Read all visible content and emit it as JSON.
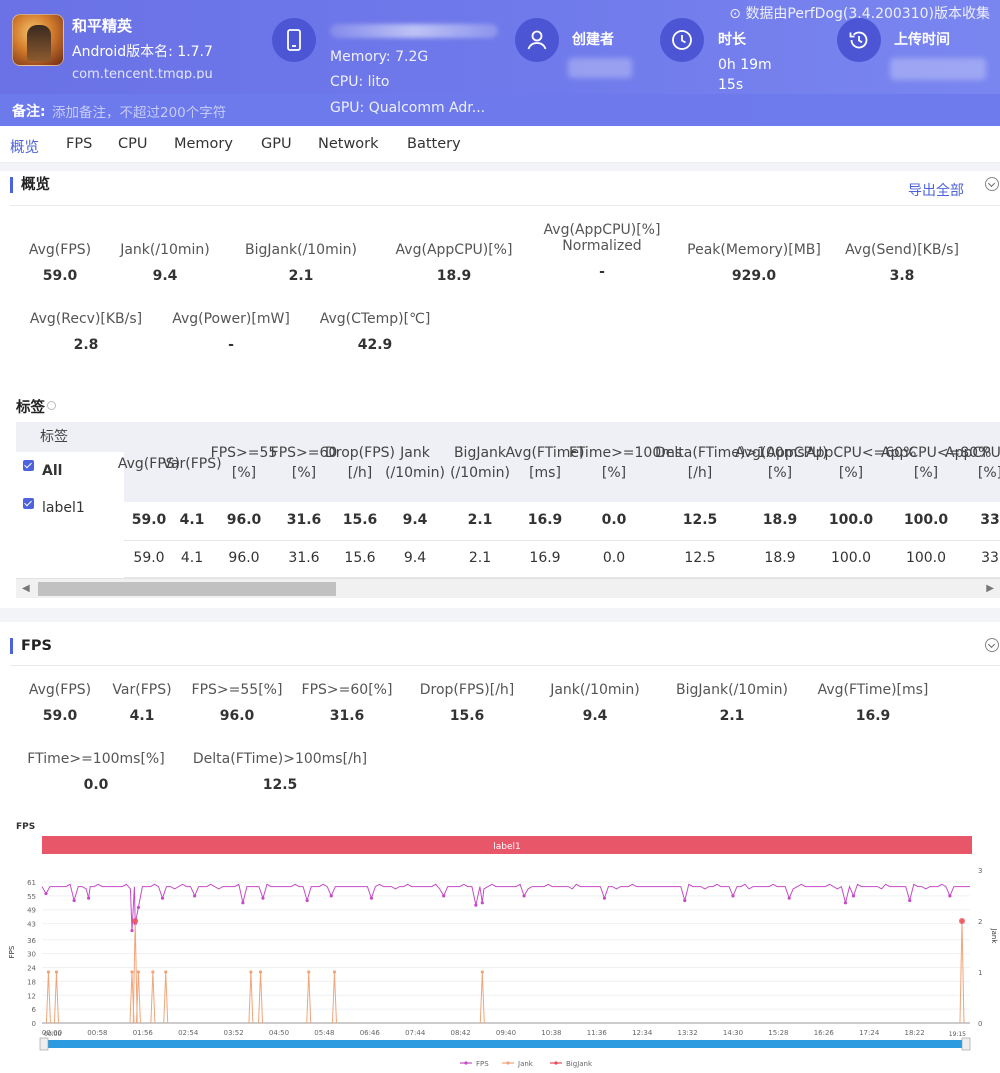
{
  "header": {
    "app_name": "和平精英",
    "app_version": "Android版本名: 1.7.7",
    "app_package": "com.tencent.tmgp.pu",
    "device_memory": "Memory: 7.2G",
    "device_cpu": "CPU: lito",
    "device_gpu": "GPU: Qualcomm Adr...",
    "creator_label": "创建者",
    "duration_label": "时长",
    "duration_value_1": "0h 19m",
    "duration_value_2": "15s",
    "upload_label": "上传时间",
    "collect_note": "数据由PerfDog(3.4.200310)版本收集",
    "note_label": "备注:",
    "note_placeholder": "添加备注，不超过200个字符"
  },
  "tabs": [
    "概览",
    "FPS",
    "CPU",
    "Memory",
    "GPU",
    "Network",
    "Battery"
  ],
  "overview": {
    "title": "概览",
    "export_label": "导出全部",
    "metrics_row1": [
      {
        "label": "Avg(FPS)",
        "value": "59.0"
      },
      {
        "label": "Jank(/10min)",
        "value": "9.4"
      },
      {
        "label": "BigJank(/10min)",
        "value": "2.1"
      },
      {
        "label": "Avg(AppCPU)[%]",
        "value": "18.9"
      },
      {
        "label": "Avg(AppCPU)[%]",
        "label2": "Normalized",
        "value": "-"
      },
      {
        "label": "Peak(Memory)[MB]",
        "value": "929.0"
      },
      {
        "label": "Avg(Send)[KB/s]",
        "value": "3.8"
      }
    ],
    "metrics_row2": [
      {
        "label": "Avg(Recv)[KB/s]",
        "value": "2.8"
      },
      {
        "label": "Avg(Power)[mW]",
        "value": "-"
      },
      {
        "label": "Avg(CTemp)[℃]",
        "value": "42.9"
      }
    ]
  },
  "tags": {
    "title": "标签",
    "col_tag": "标签",
    "headers": [
      [
        "Avg(FPS)"
      ],
      [
        "Var(FPS)"
      ],
      [
        "FPS>=55",
        "[%]"
      ],
      [
        "FPS>=60",
        "[%]"
      ],
      [
        "Drop(FPS)",
        "[/h]"
      ],
      [
        "Jank",
        "(/10min)"
      ],
      [
        "BigJank",
        "(/10min)"
      ],
      [
        "Avg(FTime)",
        "[ms]"
      ],
      [
        "FTime>=100ms",
        "[%]"
      ],
      [
        "Delta(FTime)>100ms",
        "[/h]"
      ],
      [
        "Avg(AppCPU)",
        "[%]"
      ],
      [
        "AppCPU<=60%",
        "[%]"
      ],
      [
        "AppCPU<=80%",
        "[%]"
      ],
      [
        "AppCPU<=%",
        "[%]"
      ]
    ],
    "rows": [
      {
        "name": "All",
        "values": [
          "59.0",
          "4.1",
          "96.0",
          "31.6",
          "15.6",
          "9.4",
          "2.1",
          "16.9",
          "0.0",
          "12.5",
          "18.9",
          "100.0",
          "100.0",
          "33"
        ]
      },
      {
        "name": "label1",
        "values": [
          "59.0",
          "4.1",
          "96.0",
          "31.6",
          "15.6",
          "9.4",
          "2.1",
          "16.9",
          "0.0",
          "12.5",
          "18.9",
          "100.0",
          "100.0",
          "33"
        ]
      }
    ]
  },
  "fps": {
    "title": "FPS",
    "metrics_row1": [
      {
        "label": "Avg(FPS)",
        "value": "59.0"
      },
      {
        "label": "Var(FPS)",
        "value": "4.1"
      },
      {
        "label": "FPS>=55[%]",
        "value": "96.0"
      },
      {
        "label": "FPS>=60[%]",
        "value": "31.6"
      },
      {
        "label": "Drop(FPS)[/h]",
        "value": "15.6"
      },
      {
        "label": "Jank(/10min)",
        "value": "9.4"
      },
      {
        "label": "BigJank(/10min)",
        "value": "2.1"
      },
      {
        "label": "Avg(FTime)[ms]",
        "value": "16.9"
      }
    ],
    "metrics_row2": [
      {
        "label": "FTime>=100ms[%]",
        "value": "0.0"
      },
      {
        "label": "Delta(FTime)>100ms[/h]",
        "value": "12.5"
      }
    ]
  },
  "chart_data": {
    "type": "line",
    "title": "FPS",
    "label_bar": "label1",
    "xlabel": "",
    "ylabel": "FPS",
    "y2label": "Jank",
    "x_ticks": [
      "00:00",
      "00:58",
      "01:56",
      "02:54",
      "03:52",
      "04:50",
      "05:48",
      "06:46",
      "07:44",
      "08:42",
      "09:40",
      "10:38",
      "11:36",
      "12:34",
      "13:32",
      "14:30",
      "15:28",
      "16:26",
      "17:24",
      "18:22"
    ],
    "y_ticks": [
      0,
      6,
      12,
      18,
      24,
      30,
      36,
      43,
      49,
      55,
      61
    ],
    "y2_ticks": [
      0,
      1,
      2,
      3
    ],
    "ylim": [
      0,
      61
    ],
    "y2lim": [
      0,
      3
    ],
    "legend": [
      "FPS",
      "Jank",
      "BigJank"
    ],
    "legend_position": "bottom-center",
    "series_colors": {
      "FPS": "#c54cc6",
      "Jank": "#f0a57a",
      "BigJank": "#e84a57"
    },
    "x_end_label": "19:15",
    "fps_baseline": 59,
    "fps_dips": [
      {
        "t": 5,
        "v": 56
      },
      {
        "t": 40,
        "v": 53
      },
      {
        "t": 58,
        "v": 54
      },
      {
        "t": 112,
        "v": 40
      },
      {
        "t": 116,
        "v": 43
      },
      {
        "t": 120,
        "v": 50
      },
      {
        "t": 150,
        "v": 54
      },
      {
        "t": 190,
        "v": 55
      },
      {
        "t": 250,
        "v": 52
      },
      {
        "t": 275,
        "v": 54
      },
      {
        "t": 330,
        "v": 53
      },
      {
        "t": 360,
        "v": 55
      },
      {
        "t": 410,
        "v": 54
      },
      {
        "t": 500,
        "v": 55
      },
      {
        "t": 540,
        "v": 51
      },
      {
        "t": 548,
        "v": 52
      },
      {
        "t": 600,
        "v": 55
      },
      {
        "t": 700,
        "v": 54
      },
      {
        "t": 800,
        "v": 53
      },
      {
        "t": 860,
        "v": 55
      },
      {
        "t": 930,
        "v": 54
      },
      {
        "t": 1000,
        "v": 52
      },
      {
        "t": 1010,
        "v": 55
      },
      {
        "t": 1080,
        "v": 53
      },
      {
        "t": 1130,
        "v": 55
      }
    ],
    "jank_events": [
      {
        "t": 8,
        "v": 1
      },
      {
        "t": 18,
        "v": 1
      },
      {
        "t": 112,
        "v": 1
      },
      {
        "t": 116,
        "v": 2
      },
      {
        "t": 120,
        "v": 1
      },
      {
        "t": 138,
        "v": 1
      },
      {
        "t": 154,
        "v": 1
      },
      {
        "t": 260,
        "v": 1
      },
      {
        "t": 272,
        "v": 1
      },
      {
        "t": 332,
        "v": 1
      },
      {
        "t": 364,
        "v": 1
      },
      {
        "t": 548,
        "v": 1
      },
      {
        "t": 1145,
        "v": 2
      }
    ],
    "bigjank_events": [
      {
        "t": 116,
        "v": 2
      },
      {
        "t": 1145,
        "v": 2
      }
    ]
  }
}
